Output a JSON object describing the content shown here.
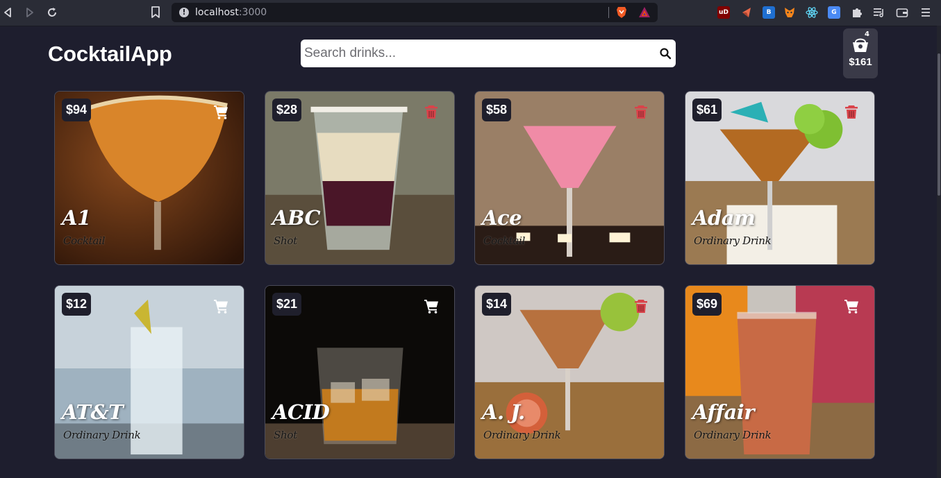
{
  "browser": {
    "url_host": "localhost",
    "url_port": ":3000"
  },
  "app": {
    "title": "CocktailApp",
    "search_placeholder": "Search drinks...",
    "cart": {
      "count": "4",
      "total": "$161"
    }
  },
  "drinks": [
    {
      "name": "A1",
      "category": "Cocktail",
      "price": "$94",
      "action": "cart-icon"
    },
    {
      "name": "ABC",
      "category": "Shot",
      "price": "$28",
      "action": "trash-icon"
    },
    {
      "name": "Ace",
      "category": "Cocktail",
      "price": "$58",
      "action": "trash-icon"
    },
    {
      "name": "Adam",
      "category": "Ordinary Drink",
      "price": "$61",
      "action": "trash-icon"
    },
    {
      "name": "AT&T",
      "category": "Ordinary Drink",
      "price": "$12",
      "action": "cart-icon"
    },
    {
      "name": "ACID",
      "category": "Shot",
      "price": "$21",
      "action": "cart-icon"
    },
    {
      "name": "A. J.",
      "category": "Ordinary Drink",
      "price": "$14",
      "action": "trash-icon"
    },
    {
      "name": "Affair",
      "category": "Ordinary Drink",
      "price": "$69",
      "action": "cart-icon"
    }
  ],
  "colors": {
    "page_bg": "#1e1e2e",
    "trash": "#d9434a",
    "cart": "#ffffff"
  }
}
